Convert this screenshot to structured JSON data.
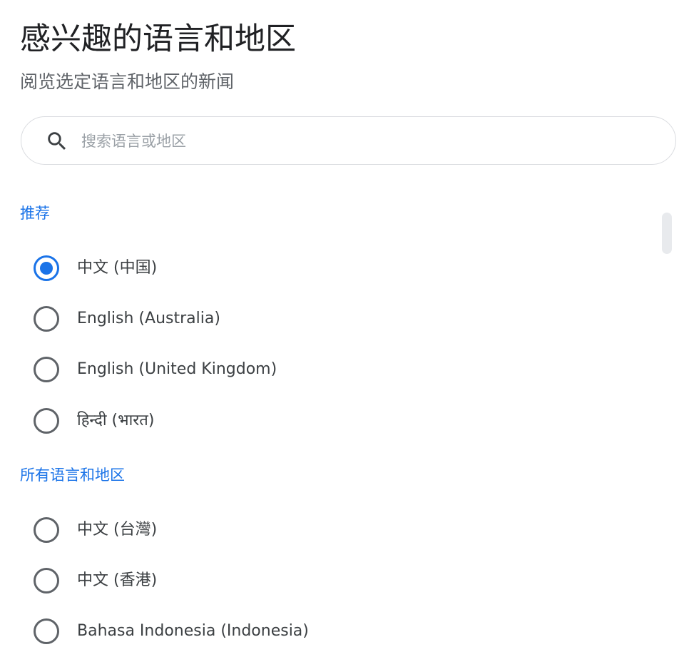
{
  "header": {
    "title": "感兴趣的语言和地区",
    "subtitle": "阅览选定语言和地区的新闻"
  },
  "search": {
    "placeholder": "搜索语言或地区",
    "value": "",
    "icon": "search-icon"
  },
  "sections": {
    "recommended": {
      "label": "推荐",
      "options": [
        {
          "label": "中文 (中国)",
          "selected": true
        },
        {
          "label": "English (Australia)",
          "selected": false
        },
        {
          "label": "English (United Kingdom)",
          "selected": false
        },
        {
          "label": "हिन्दी (भारत)",
          "selected": false
        }
      ]
    },
    "all": {
      "label": "所有语言和地区",
      "options": [
        {
          "label": "中文 (台灣)",
          "selected": false
        },
        {
          "label": "中文 (香港)",
          "selected": false
        },
        {
          "label": "Bahasa Indonesia (Indonesia)",
          "selected": false
        }
      ]
    }
  },
  "colors": {
    "accent": "#1a73e8",
    "text_primary": "#202124",
    "text_secondary": "#5f6368",
    "radio_unselected": "#5f6368",
    "border": "#dadce0"
  }
}
